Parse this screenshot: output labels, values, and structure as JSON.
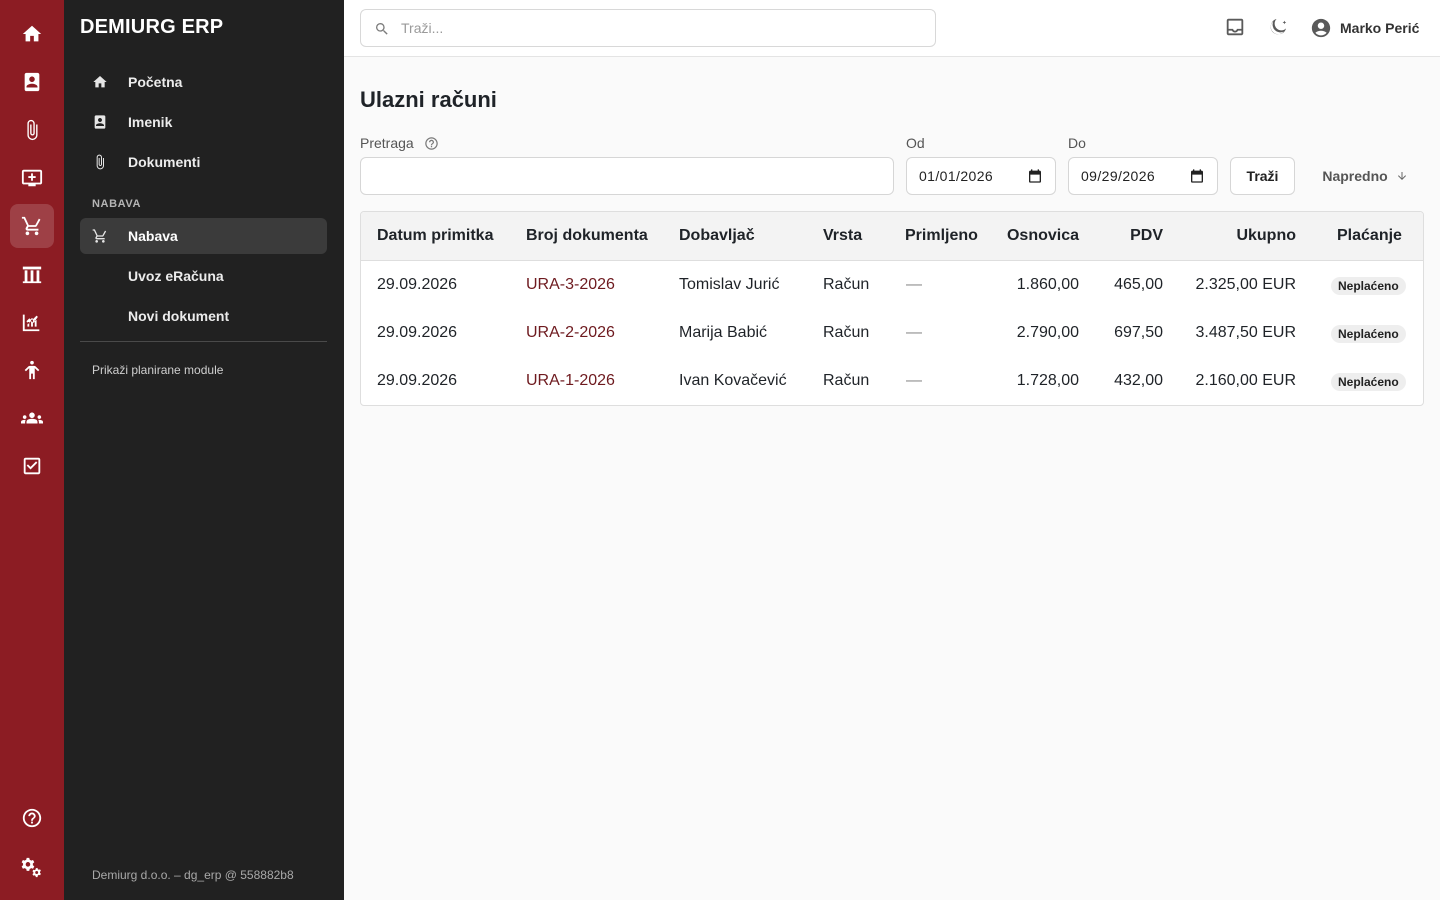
{
  "app": {
    "brand": "DEMIURG ERP"
  },
  "rail": {
    "icons": [
      "home-icon",
      "contacts-icon",
      "attachment-icon",
      "inbox-icon",
      "cart-icon",
      "warehouse-icon",
      "chart-icon",
      "person-icon",
      "people-icon",
      "tasks-icon",
      "help-icon",
      "settings-icon"
    ]
  },
  "sidebar": {
    "items": [
      {
        "label": "Početna",
        "icon": "home-icon"
      },
      {
        "label": "Imenik",
        "icon": "contacts-icon"
      },
      {
        "label": "Dokumenti",
        "icon": "attachment-icon"
      }
    ],
    "section_title": "NABAVA",
    "section_items": [
      {
        "label": "Nabava",
        "icon": "cart-icon",
        "active": true
      },
      {
        "label": "Uvoz eRačuna"
      },
      {
        "label": "Novi dokument"
      }
    ],
    "planned_link": "Prikaži planirane module",
    "footer": "Demiurg d.o.o. – dg_erp @ 558882b8"
  },
  "topbar": {
    "search_placeholder": "Traži...",
    "user_name": "Marko Perić"
  },
  "page": {
    "title": "Ulazni računi",
    "filters": {
      "search_label": "Pretraga",
      "search_value": "",
      "from_label": "Od",
      "from_value": "01/01/2026",
      "to_label": "Do",
      "to_value": "09/29/2026",
      "search_button": "Traži",
      "advanced_button": "Napredno"
    }
  },
  "table": {
    "columns": [
      "Datum primitka",
      "Broj dokumenta",
      "Dobavljač",
      "Vrsta",
      "Primljeno",
      "Osnovica",
      "PDV",
      "Ukupno",
      "Plaćanje"
    ],
    "rows": [
      {
        "date": "29.09.2026",
        "doc": "URA-3-2026",
        "supplier": "Tomislav Jurić",
        "type": "Račun",
        "received": "—",
        "base": "1.860,00",
        "vat": "465,00",
        "total": "2.325,00 EUR",
        "payment": "Neplaćeno"
      },
      {
        "date": "29.09.2026",
        "doc": "URA-2-2026",
        "supplier": "Marija Babić",
        "type": "Račun",
        "received": "—",
        "base": "2.790,00",
        "vat": "697,50",
        "total": "3.487,50 EUR",
        "payment": "Neplaćeno"
      },
      {
        "date": "29.09.2026",
        "doc": "URA-1-2026",
        "supplier": "Ivan Kovačević",
        "type": "Račun",
        "received": "—",
        "base": "1.728,00",
        "vat": "432,00",
        "total": "2.160,00 EUR",
        "payment": "Neplaćeno"
      }
    ]
  },
  "colors": {
    "rail": "#8c1c23",
    "sidebar": "#212121",
    "link": "#6e1a1f"
  }
}
